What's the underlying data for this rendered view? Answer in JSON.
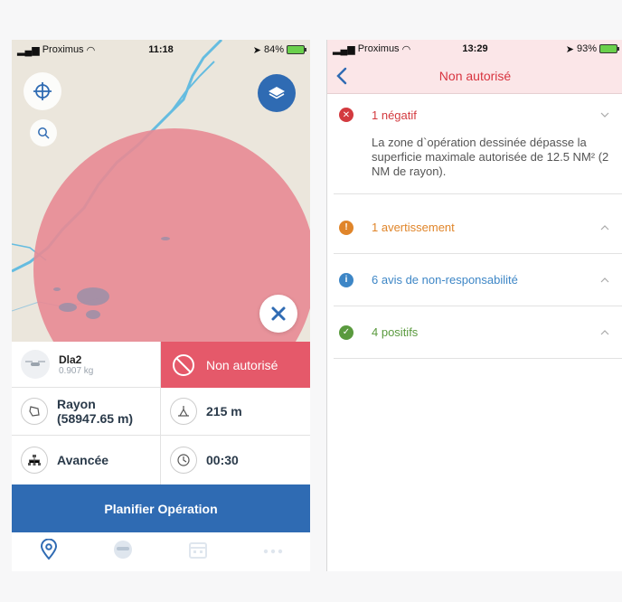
{
  "left_phone": {
    "status_bar": {
      "carrier": "Proximus",
      "time": "11:18",
      "battery": "84%"
    },
    "drone": {
      "name": "Dla2",
      "weight": "0.907 kg"
    },
    "status_label": "Non autorisé",
    "rayon": {
      "line1": "Rayon",
      "line2": "(58947.65 m)"
    },
    "altitude": "215 m",
    "mode": "Avancée",
    "duration": "00:30",
    "plan_button": "Planifier Opération",
    "tabs": [
      "location-pin-icon",
      "pilot-icon",
      "calendar-icon",
      "more-icon"
    ],
    "colors": {
      "zone_fill": "#e88a93",
      "status_red": "#e5596a",
      "primary_blue": "#2f6bb3",
      "river": "#65bce0"
    }
  },
  "right_phone": {
    "status_bar": {
      "carrier": "Proximus",
      "time": "13:29",
      "battery": "93%"
    },
    "title": "Non autorisé",
    "sections": [
      {
        "label": "1 négatif",
        "color": "#d33a3f",
        "icon": "x-circle-icon",
        "body": "La zone d`opération dessinée dépasse la superficie maximale autorisée de 12.5 NM² (2 NM de rayon).",
        "expanded": true
      },
      {
        "label": "1 avertissement",
        "color": "#e0852a",
        "icon": "exclamation-circle-icon",
        "expanded": false
      },
      {
        "label": "6 avis de non-responsabilité",
        "color": "#3d86c6",
        "icon": "info-circle-icon",
        "expanded": false
      },
      {
        "label": "4 positifs",
        "color": "#5a9a3e",
        "icon": "check-circle-icon",
        "expanded": false
      }
    ]
  }
}
